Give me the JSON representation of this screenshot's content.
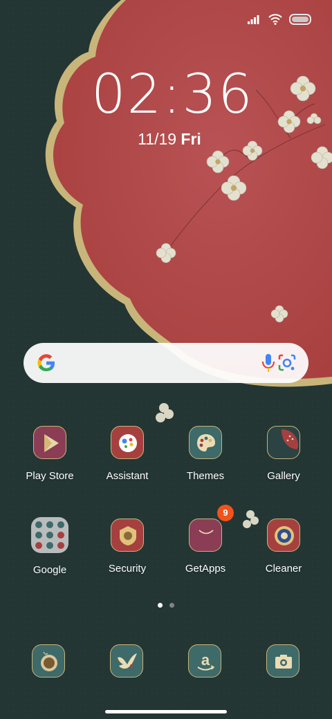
{
  "status_bar": {
    "signal_icon": "signal-bars-icon",
    "wifi_icon": "wifi-icon",
    "battery_icon": "battery-icon"
  },
  "lock": {
    "time": "02:36",
    "date": "11/19",
    "weekday": "Fri"
  },
  "search": {
    "logo_icon": "google-g-icon",
    "voice_icon": "microphone-icon",
    "lens_icon": "google-lens-icon"
  },
  "apps_row1": [
    {
      "label": "Play Store",
      "icon": "play-store-icon"
    },
    {
      "label": "Assistant",
      "icon": "assistant-icon"
    },
    {
      "label": "Themes",
      "icon": "palette-icon"
    },
    {
      "label": "Gallery",
      "icon": "gallery-icon"
    }
  ],
  "apps_row2": [
    {
      "label": "Google",
      "icon": "google-folder-icon"
    },
    {
      "label": "Security",
      "icon": "security-icon"
    },
    {
      "label": "GetApps",
      "icon": "getapps-icon",
      "badge": "9"
    },
    {
      "label": "Cleaner",
      "icon": "cleaner-icon"
    }
  ],
  "page_indicator": {
    "count": 2,
    "active": 1
  },
  "dock": [
    {
      "icon": "phone-dialer-icon"
    },
    {
      "icon": "messages-bird-icon"
    },
    {
      "icon": "amazon-icon"
    },
    {
      "icon": "camera-icon"
    }
  ],
  "colors": {
    "background": "#233634",
    "wallpaper_red": "#b5484a",
    "gold_trim": "#c8b57a",
    "badge": "#f0531c"
  }
}
